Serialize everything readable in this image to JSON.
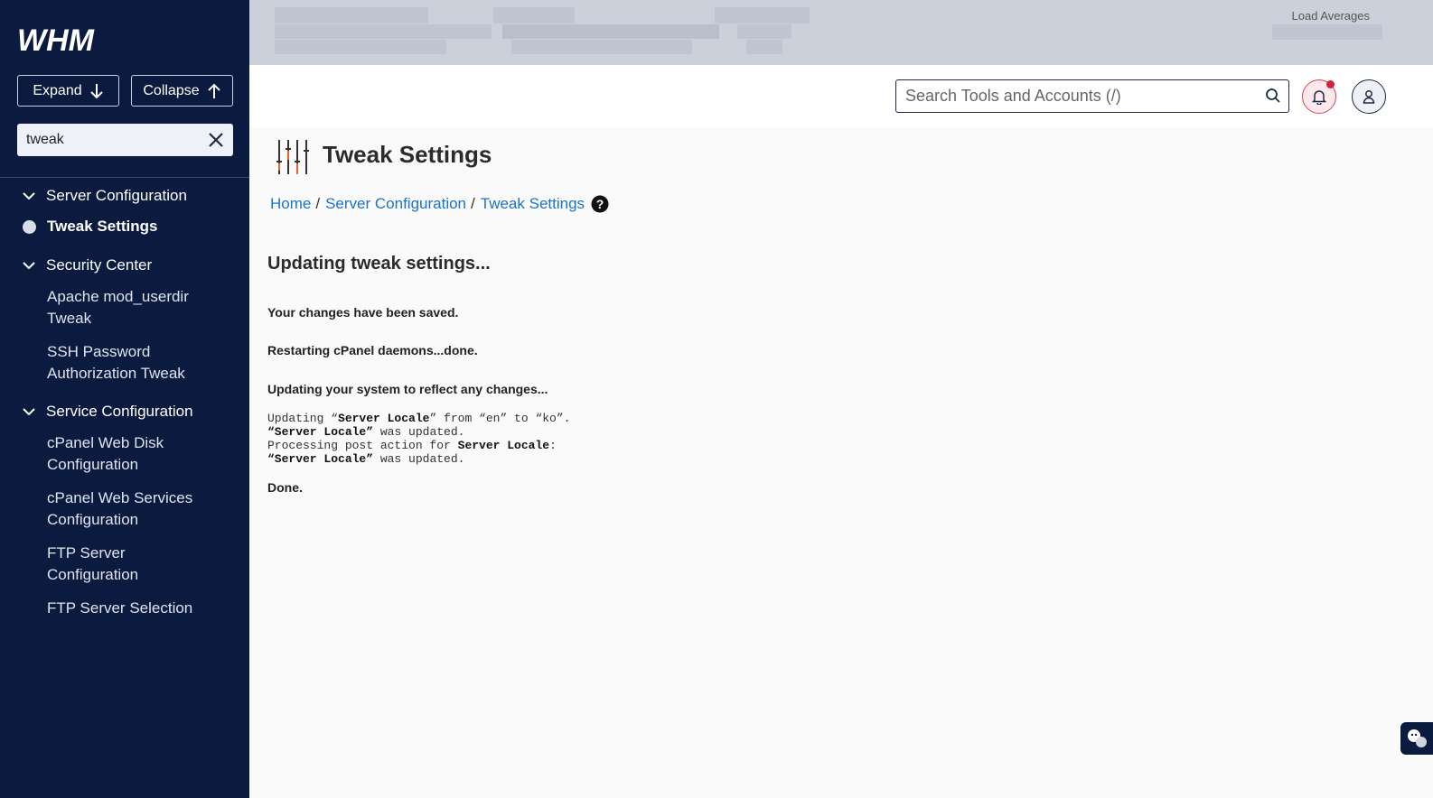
{
  "app": {
    "logo_text": "WHM"
  },
  "sidebar": {
    "expand_label": "Expand",
    "collapse_label": "Collapse",
    "filter_value": "tweak",
    "categories": [
      {
        "label": "Server Configuration",
        "items": [
          "Tweak Settings"
        ]
      },
      {
        "label": "Security Center",
        "items": [
          "Apache mod_userdir Tweak",
          "SSH Password Authorization Tweak"
        ]
      },
      {
        "label": "Service Configuration",
        "items": [
          "cPanel Web Disk Configuration",
          "cPanel Web Services Configuration",
          "FTP Server Configuration",
          "FTP Server Selection"
        ]
      }
    ]
  },
  "topstrip": {
    "load_averages_label": "Load Averages"
  },
  "header": {
    "search_placeholder": "Search Tools and Accounts (/)"
  },
  "main": {
    "title": "Tweak Settings",
    "breadcrumb": [
      "Home",
      "Server Configuration",
      "Tweak Settings"
    ],
    "heading": "Updating tweak settings...",
    "messages": [
      "Your changes have been saved.",
      "Restarting cPanel daemons...done.",
      "Updating your system to reflect any changes..."
    ],
    "log": {
      "line1_prefix": "Updating “",
      "line1_bold": "Server Locale",
      "line1_suffix": "” from “en” to “ko”.",
      "line2_bold": "“Server Locale”",
      "line2_suffix": " was updated.",
      "line3_prefix": "Processing post action for ",
      "line3_bold": "Server Locale",
      "line3_suffix": ":",
      "line4_bold": "“Server Locale”",
      "line4_suffix": " was updated."
    },
    "done": "Done."
  },
  "colors": {
    "sidebar_bg": "#0b1b3f",
    "link": "#1a73c7",
    "alert": "#d1223c"
  }
}
